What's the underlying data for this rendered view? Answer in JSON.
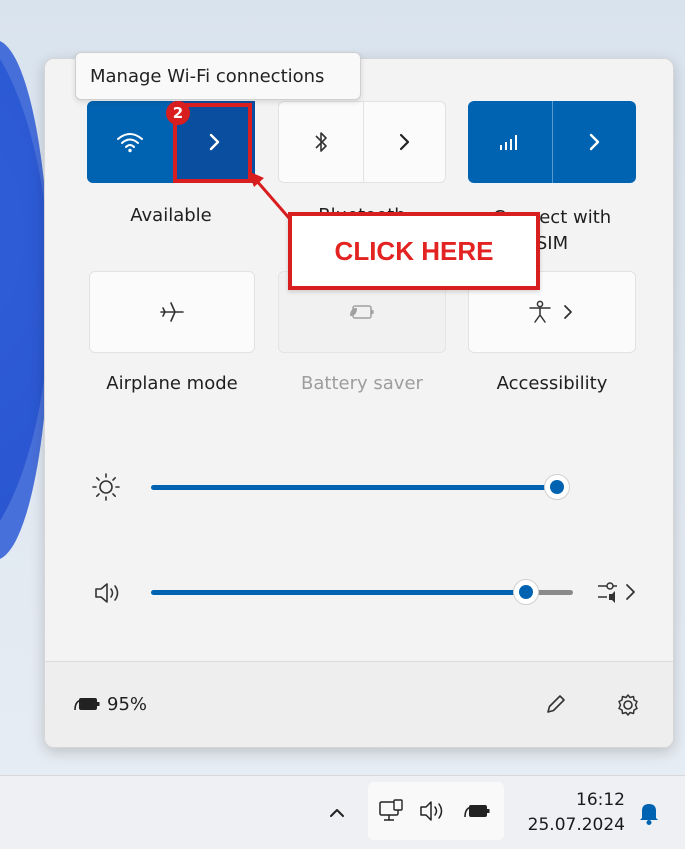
{
  "tooltip": "Manage Wi-Fi connections",
  "annotation": {
    "step_number": "2",
    "callout": "CLICK HERE",
    "color": "#d81e1e"
  },
  "quick_settings": {
    "tiles": [
      {
        "id": "wifi",
        "label": "Available",
        "state": "on",
        "icon": "wifi-icon",
        "has_chevron": true
      },
      {
        "id": "bluetooth",
        "label": "Bluetooth",
        "state": "off",
        "icon": "bluetooth-icon",
        "has_chevron": true
      },
      {
        "id": "cellular",
        "label_line1": "Connect with",
        "label_line2": "SIM",
        "state": "on",
        "icon": "cellular-signal-icon",
        "has_chevron": true
      },
      {
        "id": "airplane",
        "label": "Airplane mode",
        "state": "off",
        "icon": "airplane-icon"
      },
      {
        "id": "battery-saver",
        "label": "Battery saver",
        "state": "disabled",
        "icon": "battery-saver-icon"
      },
      {
        "id": "accessibility",
        "label": "Accessibility",
        "state": "off",
        "icon": "accessibility-icon",
        "has_chevron": true
      }
    ],
    "brightness": {
      "icon": "brightness-sun-icon",
      "level": 1.0
    },
    "volume": {
      "icon": "speaker-icon",
      "level": 0.9
    },
    "footer": {
      "battery_percent": "95%",
      "edit_icon": "pencil-icon",
      "settings_icon": "gear-icon"
    }
  },
  "taskbar": {
    "overflow_icon": "chevron-up-icon",
    "tray_icons": [
      "network-icon",
      "volume-icon",
      "battery-icon"
    ],
    "time": "16:12",
    "date": "25.07.2024",
    "notification_icon": "bell-icon"
  },
  "colors": {
    "accent": "#0063b1",
    "panel_bg": "#f3f3f3"
  }
}
